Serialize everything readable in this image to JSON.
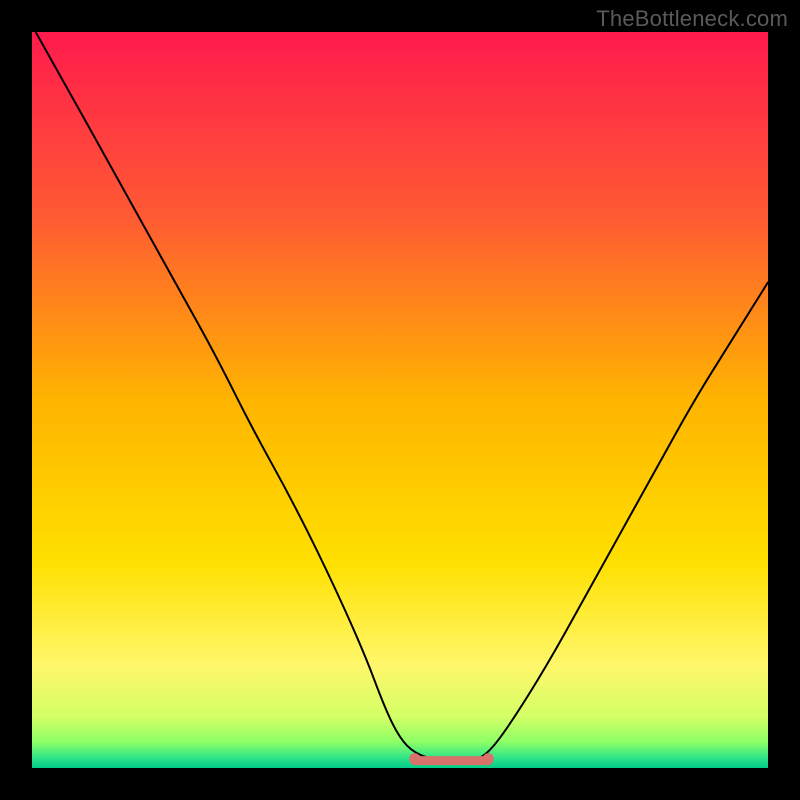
{
  "watermark": "TheBottleneck.com",
  "chart_data": {
    "type": "line",
    "title": "",
    "xlabel": "",
    "ylabel": "",
    "xlim": [
      0,
      100
    ],
    "ylim": [
      0,
      100
    ],
    "legend": null,
    "grid": false,
    "background_gradient": {
      "stops": [
        {
          "pos": 0.0,
          "color": "#ff1a4d"
        },
        {
          "pos": 0.25,
          "color": "#ff5a33"
        },
        {
          "pos": 0.5,
          "color": "#ffb400"
        },
        {
          "pos": 0.72,
          "color": "#ffe000"
        },
        {
          "pos": 0.86,
          "color": "#fff76b"
        },
        {
          "pos": 0.93,
          "color": "#d4ff66"
        },
        {
          "pos": 0.965,
          "color": "#8cff66"
        },
        {
          "pos": 0.985,
          "color": "#33e688"
        },
        {
          "pos": 1.0,
          "color": "#00cc88"
        }
      ]
    },
    "series": [
      {
        "name": "bottleneck-curve",
        "color": "#000000",
        "x": [
          0.5,
          5,
          10,
          15,
          20,
          25,
          30,
          35,
          40,
          45,
          48,
          50,
          52,
          55,
          57,
          59,
          60,
          62,
          65,
          70,
          75,
          80,
          85,
          90,
          95,
          100
        ],
        "y": [
          100,
          92,
          83,
          74,
          65,
          56,
          46,
          37,
          27,
          16,
          8,
          4,
          2,
          1.0,
          1.0,
          1.0,
          1.0,
          2,
          6,
          14,
          23,
          32,
          41,
          50,
          58,
          66
        ]
      },
      {
        "name": "optimal-marker",
        "type": "marker-band",
        "color": "#d9726b",
        "x_range": [
          52,
          62
        ],
        "y": 1.0
      }
    ],
    "annotations": []
  }
}
